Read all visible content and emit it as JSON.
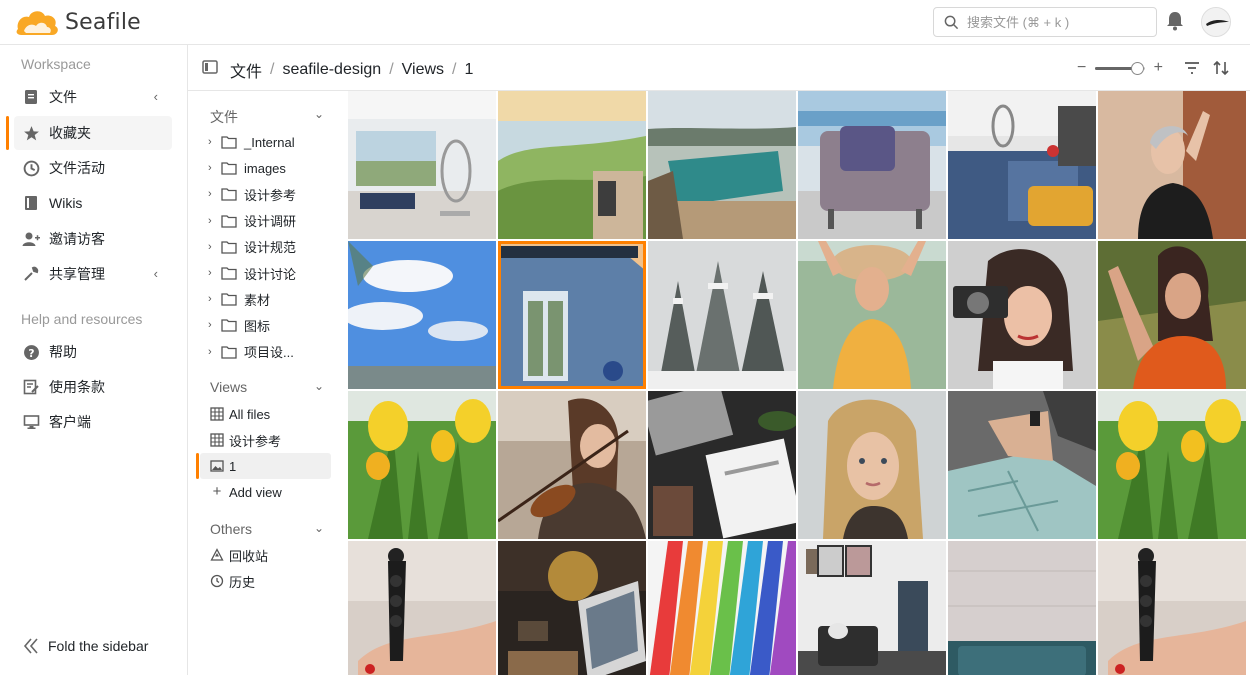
{
  "app": {
    "name": "Seafile"
  },
  "header": {
    "search_placeholder": "搜索文件 (⌘ + k )"
  },
  "sidebar": {
    "workspace_title": "Workspace",
    "items": [
      {
        "label": "文件",
        "icon": "file-icon"
      },
      {
        "label": "收藏夹",
        "icon": "star-icon"
      },
      {
        "label": "文件活动",
        "icon": "clock-icon"
      },
      {
        "label": "Wikis",
        "icon": "wiki-icon"
      },
      {
        "label": "邀请访客",
        "icon": "invite-icon"
      },
      {
        "label": "共享管理",
        "icon": "share-manage-icon"
      }
    ],
    "help_title": "Help and resources",
    "help_items": [
      {
        "label": "帮助",
        "icon": "help-icon"
      },
      {
        "label": "使用条款",
        "icon": "terms-icon"
      },
      {
        "label": "客户端",
        "icon": "client-icon"
      }
    ],
    "fold_label": "Fold the sidebar"
  },
  "breadcrumb": [
    "文件",
    "seafile-design",
    "Views",
    "1"
  ],
  "zoom": {
    "level": 0.85
  },
  "tree": {
    "files_title": "文件",
    "folders": [
      "_Internal",
      "images",
      "设计参考",
      "设计调研",
      "设计规范",
      "设计讨论",
      "素材",
      "图标",
      "项目设..."
    ],
    "views_title": "Views",
    "views": [
      "All files",
      "设计参考",
      "1"
    ],
    "add_view": "Add view",
    "others_title": "Others",
    "others": [
      "回收站",
      "历史"
    ]
  },
  "colors": {
    "accent": "#ff8000",
    "logo": "#f9a825"
  },
  "gallery": {
    "selected_index": 7,
    "tiles": [
      "living-room",
      "green-hills",
      "pool",
      "armchair",
      "patio",
      "woman-wall",
      "blue-sky",
      "blue-house",
      "snowy-trees",
      "woman-hat",
      "woman-camera",
      "woman-orange",
      "yellow-tulips",
      "violinist",
      "laptop-calendar",
      "blonde-woman",
      "map-hands",
      "yellow-tulips",
      "hand-tripod",
      "laptop-plant",
      "color-swatches",
      "room-frames",
      "concrete-wall",
      "hand-tripod"
    ]
  }
}
